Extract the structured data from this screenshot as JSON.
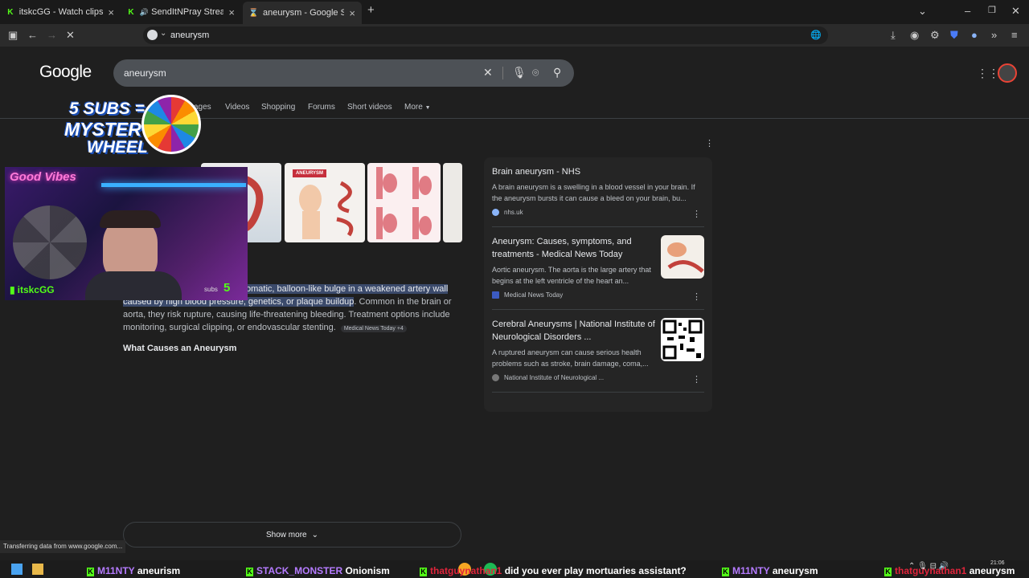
{
  "tabs": [
    {
      "title": "itskcGG - Watch clips on Kick",
      "active": false
    },
    {
      "title": "SendItNPray Stream - Watc",
      "active": false
    },
    {
      "title": "aneurysm - Google Search",
      "active": true
    }
  ],
  "address_bar": {
    "value": "aneurysm"
  },
  "google": {
    "logo": "Google",
    "query": "aneurysm",
    "nav_tabs": [
      "ages",
      "Videos",
      "Shopping",
      "Forums",
      "Short videos",
      "More"
    ]
  },
  "overview": {
    "highlight_line1": "omatic, balloon-like bulge in a weakened artery wall",
    "highlight_line2": "caused by high blood pressure, genetics, or plaque buildup",
    "rest_line2": ". Common in the brain or",
    "line3": "aorta, they risk rupture, causing life-threatening bleeding. Treatment options include",
    "line4": "monitoring, surgical clipping, or endovascular stenting.",
    "source_chip": "Medical News Today +4",
    "heading": "What Causes an Aneurysm",
    "image_label": "ANEURYSM"
  },
  "side_results": [
    {
      "title": "Brain aneurysm - NHS",
      "desc": "A brain aneurysm is a swelling in a blood vessel in your brain. If the aneurysm bursts it can cause a bleed on your brain, bu...",
      "source": "nhs.uk"
    },
    {
      "title": "Aneurysm: Causes, symptoms, and treatments - Medical News Today",
      "desc": "Aortic aneurysm. The aorta is the large artery that begins at the left ventricle of the heart an...",
      "source": "Medical News Today"
    },
    {
      "title": "Cerebral Aneurysms | National Institute of Neurological Disorders ...",
      "desc": "A ruptured aneurysm can cause serious health problems such as stroke, brain damage, coma,...",
      "source": "National Institute of Neurological ..."
    }
  ],
  "show_more": "Show more",
  "status_bar": "Transferring data from www.google.com...",
  "overlay": {
    "promo_line1": "5 SUBS =",
    "promo_line2": "MYSTERY",
    "promo_line3": "WHEEL",
    "webcam_sign": "Good Vibes",
    "streamer_name": "itskcGG",
    "subs_label": "subs",
    "subs_count": "5"
  },
  "ticker": [
    {
      "user": "M11NTY",
      "message": "aneurism"
    },
    {
      "user": "STACK_MONSTER",
      "message": "Onionism"
    },
    {
      "user": "thatguynathan1",
      "message": "did you ever play mortuaries assistant?"
    },
    {
      "user": "M11NTY",
      "message": "aneurysm"
    },
    {
      "user": "thatguynathan1",
      "message": "aneurysm"
    }
  ],
  "clock": "21:06",
  "colors": {
    "accent_green": "#53fc18",
    "ticker_user": "#b57bff",
    "ticker_red": "#e0243b",
    "highlight": "#3b4a6b"
  }
}
